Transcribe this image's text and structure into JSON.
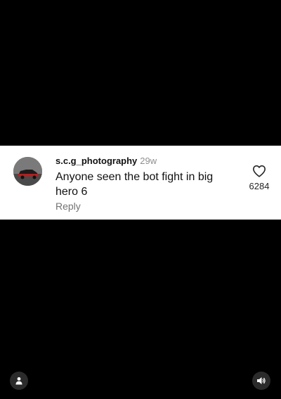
{
  "comment": {
    "username": "s.c.g_photography",
    "timestamp": "29w",
    "text": "Anyone seen the bot fight in big hero 6",
    "reply_label": "Reply",
    "like_count": "6284",
    "avatar_icon": "car-avatar",
    "like_icon": "heart-outline-icon"
  },
  "controls": {
    "user_icon": "user-icon",
    "sound_icon": "speaker-icon"
  },
  "colors": {
    "background": "#000000",
    "card": "#ffffff",
    "muted_text": "#737373"
  }
}
